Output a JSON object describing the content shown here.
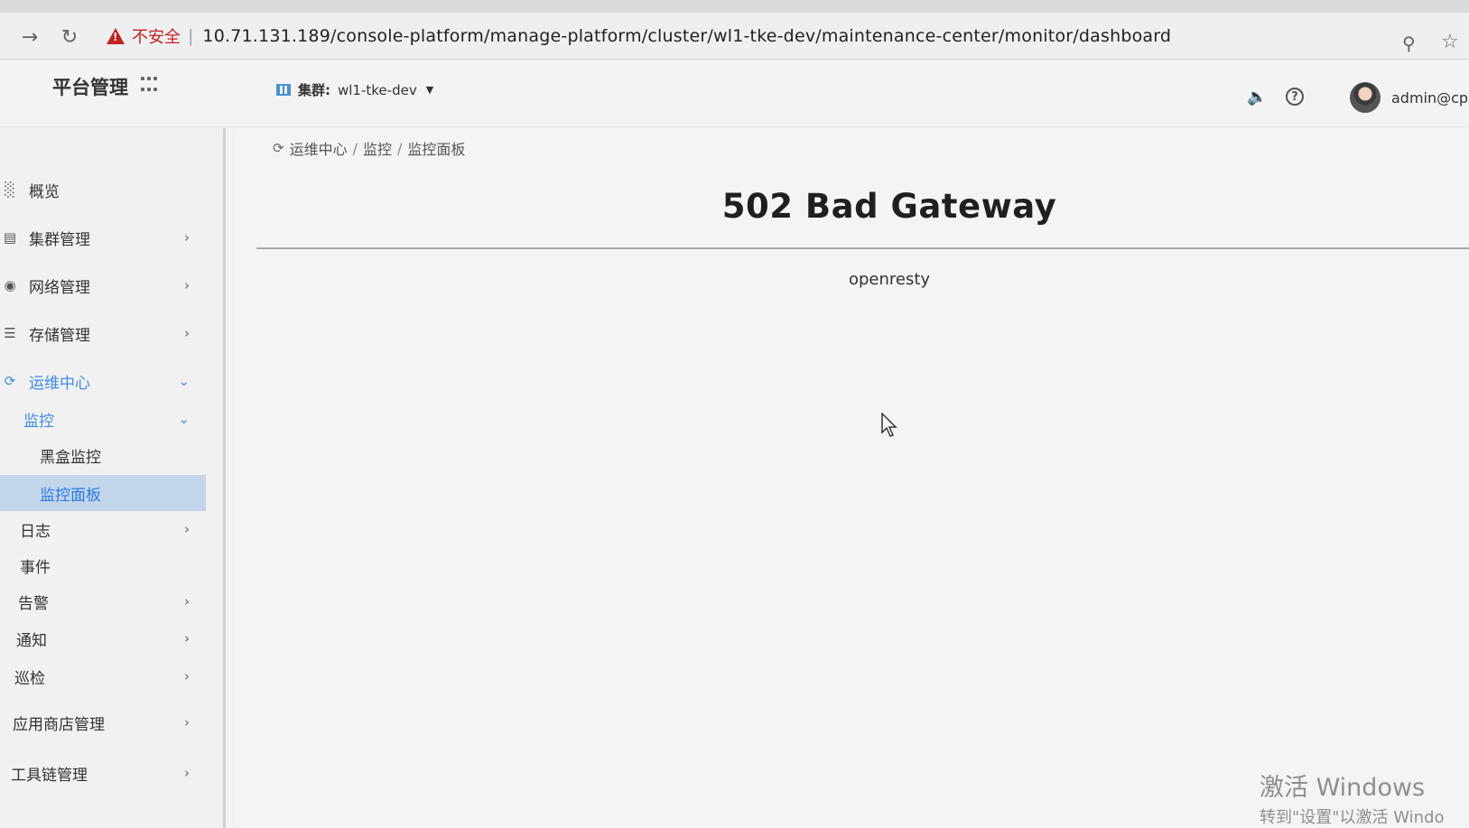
{
  "browser": {
    "security_label": "不安全",
    "separator": "|",
    "url": "10.71.131.189/console-platform/manage-platform/cluster/wl1-tke-dev/maintenance-center/monitor/dashboard"
  },
  "header": {
    "brand": "平台管理",
    "cluster_label": "集群:",
    "cluster_value": "wl1-tke-dev",
    "user": "admin@cpa"
  },
  "sidebar": {
    "items": [
      {
        "label": "概览"
      },
      {
        "label": "集群管理"
      },
      {
        "label": "网络管理"
      },
      {
        "label": "存储管理"
      },
      {
        "label": "运维中心"
      },
      {
        "label": "监控"
      },
      {
        "label": "黑盒监控"
      },
      {
        "label": "监控面板"
      },
      {
        "label": "日志"
      },
      {
        "label": "事件"
      },
      {
        "label": "告警"
      },
      {
        "label": "通知"
      },
      {
        "label": "巡检"
      },
      {
        "label": "应用商店管理"
      },
      {
        "label": "工具链管理"
      }
    ]
  },
  "breadcrumb": [
    "运维中心",
    "/",
    "监控",
    "/",
    "监控面板"
  ],
  "error": {
    "title": "502 Bad Gateway",
    "server": "openresty"
  },
  "windows_activation": {
    "line1": "激活 Windows",
    "line2": "转到\"设置\"以激活 Windo"
  }
}
